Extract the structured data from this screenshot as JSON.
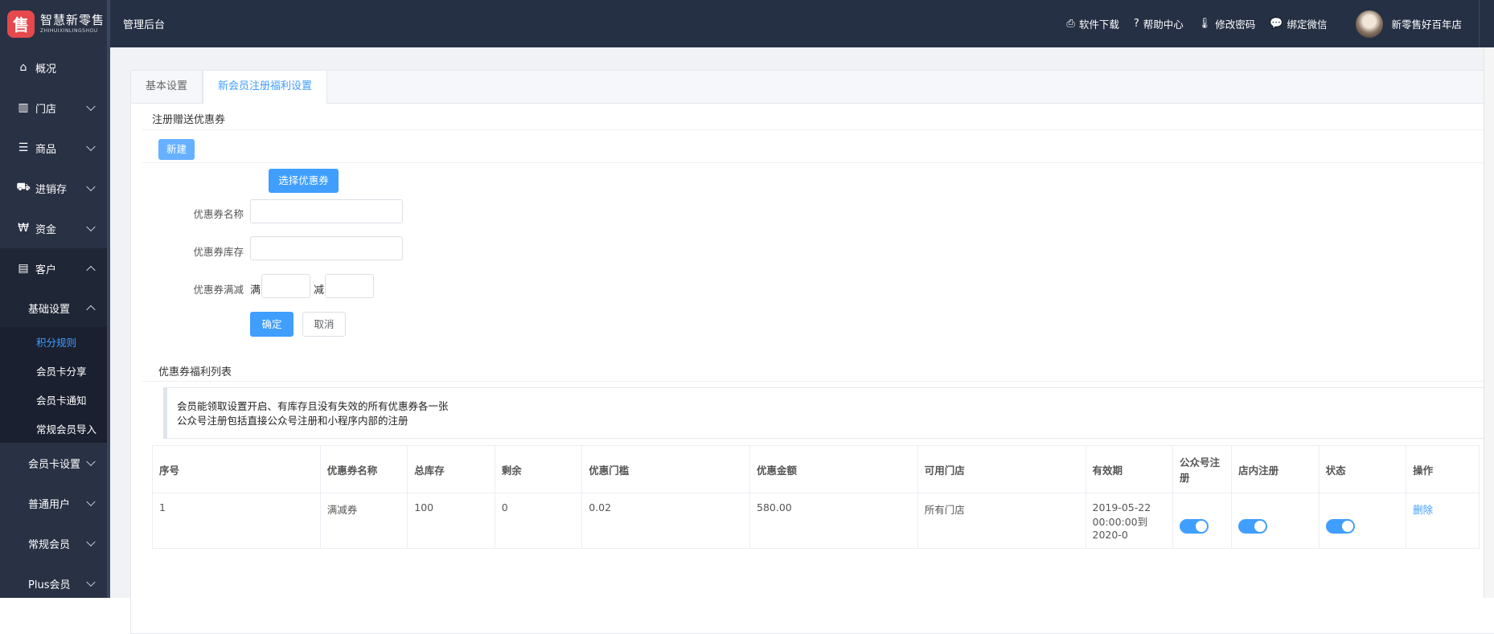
{
  "brand": {
    "logo_glyph": "售",
    "name": "智慧新零售",
    "subtitle": "ZHIHUIXINLINGSHOU"
  },
  "header": {
    "title": "管理后台",
    "links": [
      {
        "label": "软件下载",
        "icon": "printer-icon",
        "glyph": "⎙"
      },
      {
        "label": "帮助中心",
        "icon": "help-circle-icon",
        "glyph": "?"
      },
      {
        "label": "修改密码",
        "icon": "thermometer-icon",
        "glyph": "🌡"
      },
      {
        "label": "绑定微信",
        "icon": "chat-bubbles-icon",
        "glyph": "💬"
      }
    ],
    "user_name": "新零售好百年店"
  },
  "sidebar": {
    "items": [
      {
        "label": "概况",
        "icon": "home-icon",
        "glyph": "⌂"
      },
      {
        "label": "门店",
        "icon": "building-icon",
        "glyph": "▥"
      },
      {
        "label": "商品",
        "icon": "list-icon",
        "glyph": "☰"
      },
      {
        "label": "进销存",
        "icon": "truck-icon",
        "glyph": "⛟"
      },
      {
        "label": "资金",
        "icon": "won-icon",
        "glyph": "₩"
      },
      {
        "label": "客户",
        "icon": "id-card-icon",
        "glyph": "▤"
      }
    ],
    "customer_sub": {
      "title": "基础设置",
      "children": [
        "积分规则",
        "会员卡分享",
        "会员卡通知",
        "常规会员导入"
      ]
    },
    "groups": [
      "会员卡设置",
      "普通用户",
      "常规会员",
      "Plus会员"
    ]
  },
  "tabs": [
    "基本设置",
    "新会员注册福利设置"
  ],
  "coupon_section": {
    "title": "注册赠送优惠券",
    "new_button": "新建",
    "select_button": "选择优惠券",
    "fields": {
      "name_label": "优惠券名称",
      "name_value": "",
      "stock_label": "优惠券库存",
      "stock_value": "",
      "threshold_label": "优惠券满减",
      "man": "满",
      "jian": "减",
      "man_value": "",
      "jian_value": ""
    },
    "confirm_button": "确定",
    "cancel_button": "取消"
  },
  "list_section": {
    "title": "优惠券福利列表",
    "notice": [
      "会员能领取设置开启、有库存且没有失效的所有优惠券各一张",
      "公众号注册包括直接公众号注册和小程序内部的注册"
    ],
    "columns": [
      "序号",
      "优惠券名称",
      "总库存",
      "剩余",
      "优惠门槛",
      "优惠金额",
      "可用门店",
      "有效期",
      "公众号注册",
      "店内注册",
      "状态",
      "操作"
    ],
    "rows": [
      {
        "index": "1",
        "name": "满减券",
        "total": "100",
        "remain": "0",
        "threshold": "0.02",
        "amount": "580.00",
        "store": "所有门店",
        "validity": "2019-05-22 00:00:00到2020-0",
        "wechat_on": true,
        "store_on": true,
        "status_on": true,
        "action": "删除"
      }
    ]
  }
}
